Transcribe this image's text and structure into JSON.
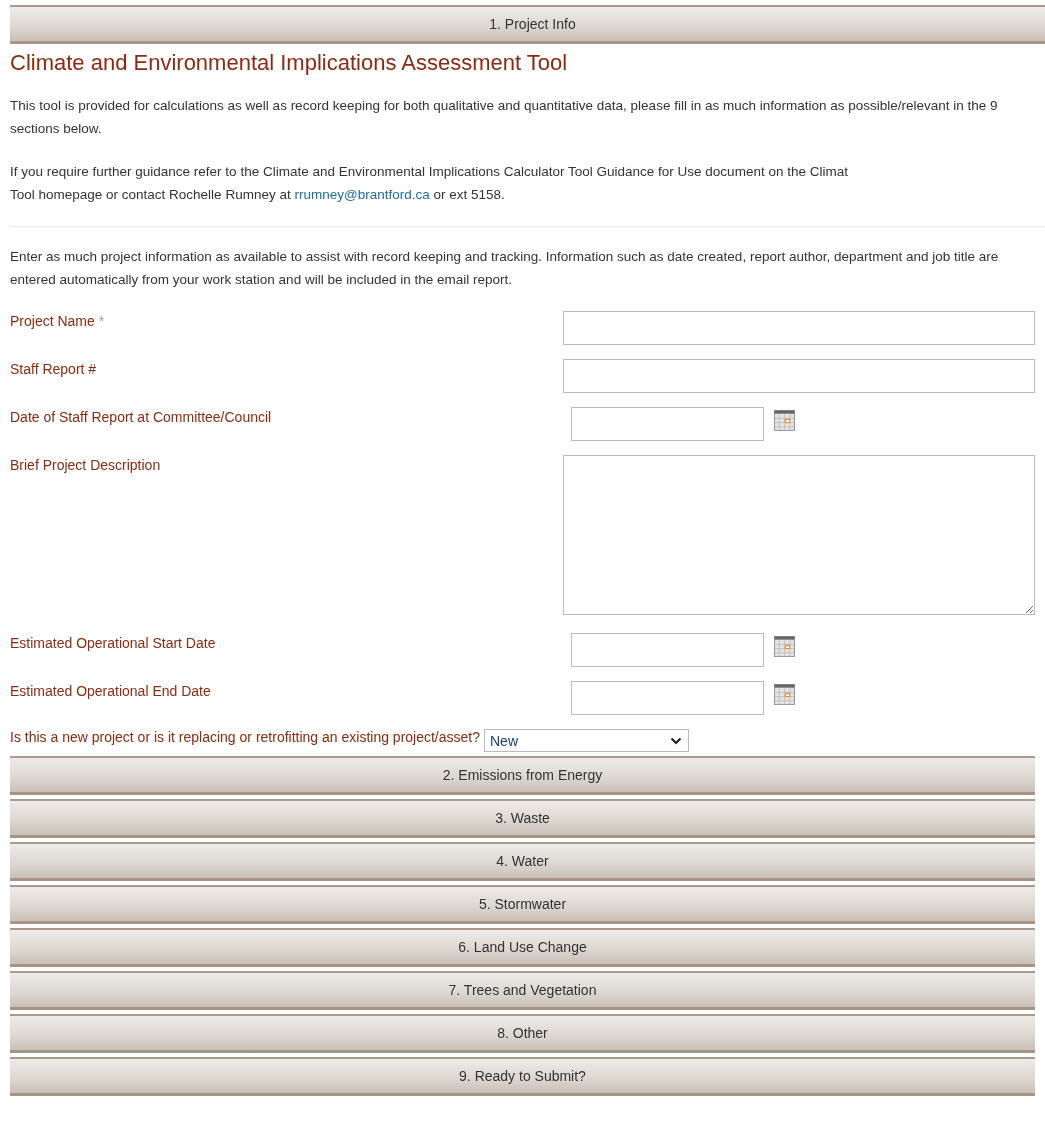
{
  "sections": [
    {
      "title": "1. Project Info"
    }
  ],
  "heading": "Climate and Environmental Implications Assessment Tool",
  "intro": [
    "This tool is provided for calculations as well as record keeping for both qualitative and quantitative data, please fill in as much information as possible/relevant in the 9 sections below."
  ],
  "guidance": {
    "line_1": "If you require further guidance refer to the Climate and Environmental Implications Calculator Tool Guidance for Use document on the Climat",
    "line_2_before": "Tool homepage or contact Rochelle Rumney at",
    "link": "rrumney@brantford.ca",
    "line_2_after": "or ext 5158."
  },
  "note": "Enter as much project information as available to assist with record keeping and tracking. Information such as date created, report author, department and job title are entered automatically from your work station and will be included in the email report.",
  "fields": [
    {
      "kind": "text",
      "label": "Project Name",
      "required_mark": "*"
    },
    {
      "kind": "text",
      "label": "Staff Report #"
    },
    {
      "kind": "date",
      "label": "Date of Staff Report at Committee/Council"
    },
    {
      "kind": "textarea",
      "label": "Brief Project Description"
    },
    {
      "kind": "date",
      "label": "Estimated Operational Start Date"
    },
    {
      "kind": "date",
      "label": "Estimated Operational End Date"
    },
    {
      "kind": "select",
      "label": "Is this a new project or is it replacing or retrofitting an existing project/asset?",
      "value": "New"
    }
  ],
  "more_sections": [
    {
      "title": "2. Emissions from Energy"
    },
    {
      "title": "3. Waste"
    },
    {
      "title": "4. Water"
    },
    {
      "title": "5. Stormwater"
    },
    {
      "title": "6. Land Use Change"
    },
    {
      "title": "7. Trees and Vegetation"
    },
    {
      "title": "8. Other"
    },
    {
      "title": "9. Ready to Submit?"
    }
  ]
}
